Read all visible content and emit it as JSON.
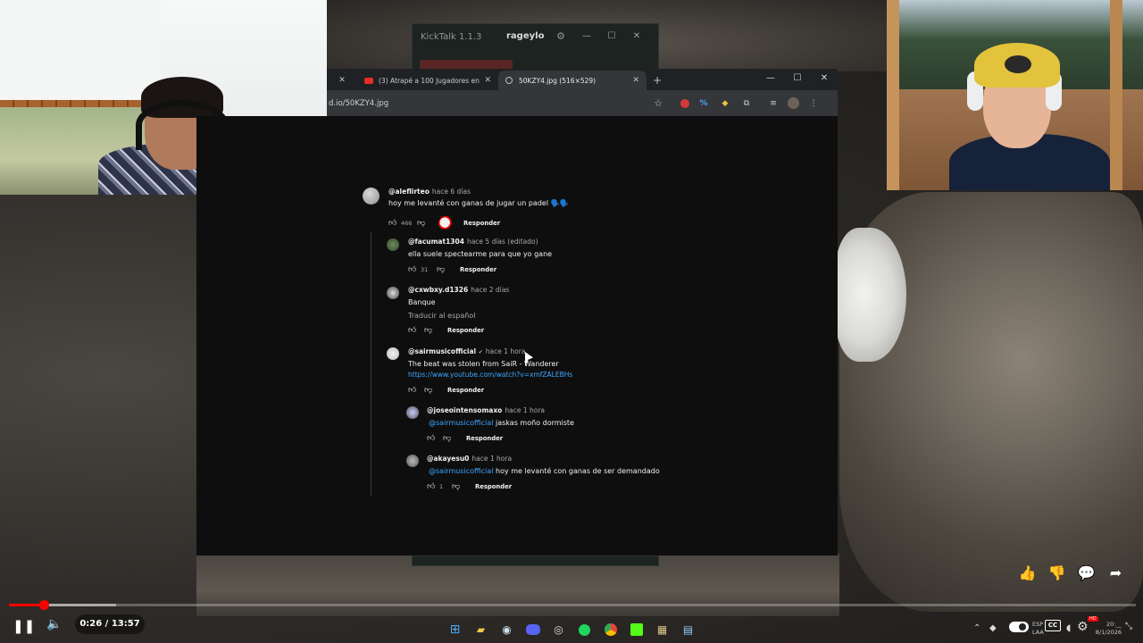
{
  "kicktalk": {
    "title": "KickTalk 1.1.3",
    "user": "rageylo",
    "gear_icon": "⚙",
    "minimize": "—",
    "maximize": "☐",
    "close": "✕"
  },
  "chrome": {
    "tabs": [
      {
        "label": "(3) Atrapé a 100 Jugadores en ...",
        "favicon": "youtube-icon"
      },
      {
        "label": "50KZY4.jpg (516×529)",
        "favicon": "image-icon"
      }
    ],
    "prev_tab_close": "✕",
    "tab_close": "✕",
    "new_tab": "+",
    "url": "d.io/50KZY4.jpg",
    "window_minimize": "—",
    "window_maximize": "☐",
    "window_close": "✕"
  },
  "comments": [
    {
      "handle": "@aleflirteo",
      "time": "hace 6 días",
      "text": "hoy me levanté con ganas de jugar un padel 🗣️🗣️",
      "likes": "466",
      "reply_label": "Responder"
    },
    {
      "handle": "@facumat1304",
      "time": "hace 5 días (editado)",
      "text": "ella suele spectearme para que yo gane",
      "likes": "31",
      "reply_label": "Responder"
    },
    {
      "handle": "@cxwbxy.d1326",
      "time": "hace 2 días",
      "text": "Banque",
      "translate": "Traducir al español",
      "likes": "",
      "reply_label": "Responder"
    },
    {
      "handle": "@sairmusicofficial",
      "verified": "✔",
      "time": "hace 1 hora",
      "text": "The beat was stolen from SaiR - Wanderer",
      "link": "https://www.youtube.com/watch?v=xmfZALEBHs",
      "likes": "",
      "reply_label": "Responder"
    },
    {
      "handle": "@joseointensomaxo",
      "time": "hace 1 hora",
      "mention": "@sairmusicofficial",
      "text": "jaskas moño dormiste",
      "likes": "",
      "reply_label": "Responder"
    },
    {
      "handle": "@akayesu0",
      "time": "hace 1 hora",
      "mention": "@sairmusicofficial",
      "text": "hoy me levanté con ganas de ser demandado",
      "likes": "1",
      "reply_label": "Responder"
    }
  ],
  "player": {
    "time": "0:26 / 13:57",
    "progress_fraction": 0.031,
    "buffer_fraction": 0.095,
    "pause_icon": "❚❚",
    "volume_icon": "🔈"
  },
  "side_actions": [
    "👍",
    "👎",
    "💬",
    "➦"
  ],
  "tray": {
    "lang_line1": "ESP",
    "lang_line2": "LAA",
    "cc": "CC",
    "hd": "HD",
    "clock_line1": "20:__",
    "clock_line2": "8/1/2026"
  },
  "taskbar_icons": [
    "windows-icon",
    "files-icon",
    "steam-icon",
    "discord-icon",
    "obs-icon",
    "spotify-icon",
    "chrome-icon",
    "kick-icon",
    "gallery-icon",
    "notepad-icon"
  ],
  "colors": {
    "youtube_red": "#ff0000",
    "link_blue": "#3ea6ff",
    "chrome_dark": "#202124"
  }
}
